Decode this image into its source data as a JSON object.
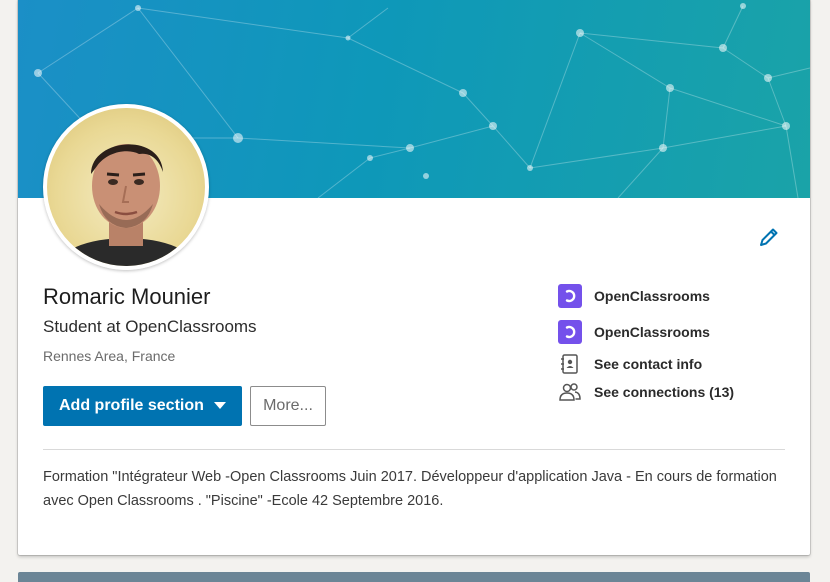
{
  "profile": {
    "name": "Romaric Mounier",
    "headline": "Student at OpenClassrooms",
    "location": "Rennes Area, France",
    "summary": "Formation \"Intégrateur Web -Open Classrooms Juin 2017. Développeur d'application Java - En cours de formation avec Open Classrooms . \"Piscine\" -Ecole 42 Septembre 2016."
  },
  "actions": {
    "add_section_label": "Add profile section",
    "more_label": "More..."
  },
  "sidebar": {
    "items": [
      {
        "label": "OpenClassrooms",
        "icon": "openclassrooms-logo-icon"
      },
      {
        "label": "OpenClassrooms",
        "icon": "openclassrooms-logo-icon"
      },
      {
        "label": "See contact info",
        "icon": "contact-book-icon"
      },
      {
        "label": "See connections (13)",
        "icon": "people-icon"
      }
    ]
  },
  "colors": {
    "primary_button": "#0073b1",
    "edit_icon": "#0073b1",
    "openclassrooms_brand": "#7451eb",
    "banner_start": "#1b8fc7",
    "banner_end": "#1aa3a8"
  }
}
